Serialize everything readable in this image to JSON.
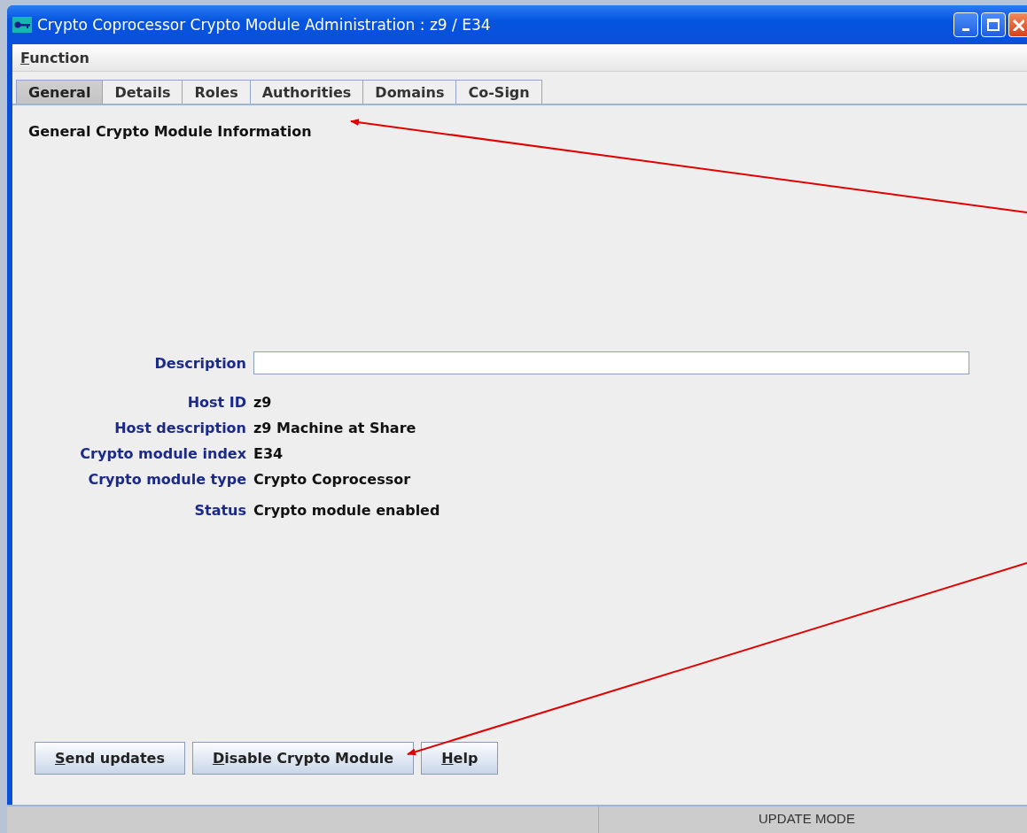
{
  "window": {
    "title": "Crypto Coprocessor Crypto Module Administration : z9 / E34"
  },
  "menu": [
    {
      "label": "Function",
      "mnemonic_underlined": true
    }
  ],
  "tabs": [
    {
      "label": "General",
      "selected": true
    },
    {
      "label": "Details",
      "selected": false
    },
    {
      "label": "Roles",
      "selected": false
    },
    {
      "label": "Authorities",
      "selected": false
    },
    {
      "label": "Domains",
      "selected": false
    },
    {
      "label": "Co-Sign",
      "selected": false
    }
  ],
  "panel": {
    "heading": "General Crypto Module Information",
    "fields": [
      {
        "kind": "input",
        "label": "Description"
      },
      {
        "kind": "text",
        "label": "Host ID",
        "value": "z9"
      },
      {
        "kind": "text",
        "label": "Host description",
        "value": "z9 Machine at Share"
      },
      {
        "kind": "text",
        "label": "Crypto module index",
        "value": "E34"
      },
      {
        "kind": "text",
        "label": "Crypto module type",
        "value": "Crypto Coprocessor"
      },
      {
        "kind": "text",
        "label": "Status",
        "value": "Crypto module enabled"
      }
    ]
  },
  "buttons": [
    {
      "label": "Send updates",
      "mnemonic_underlined": true
    },
    {
      "label": "Disable Crypto Module",
      "mnemonic_underlined": true
    },
    {
      "label": "Help",
      "mnemonic_underlined": true
    }
  ],
  "status_bar": {
    "mode": "UPDATE MODE"
  }
}
